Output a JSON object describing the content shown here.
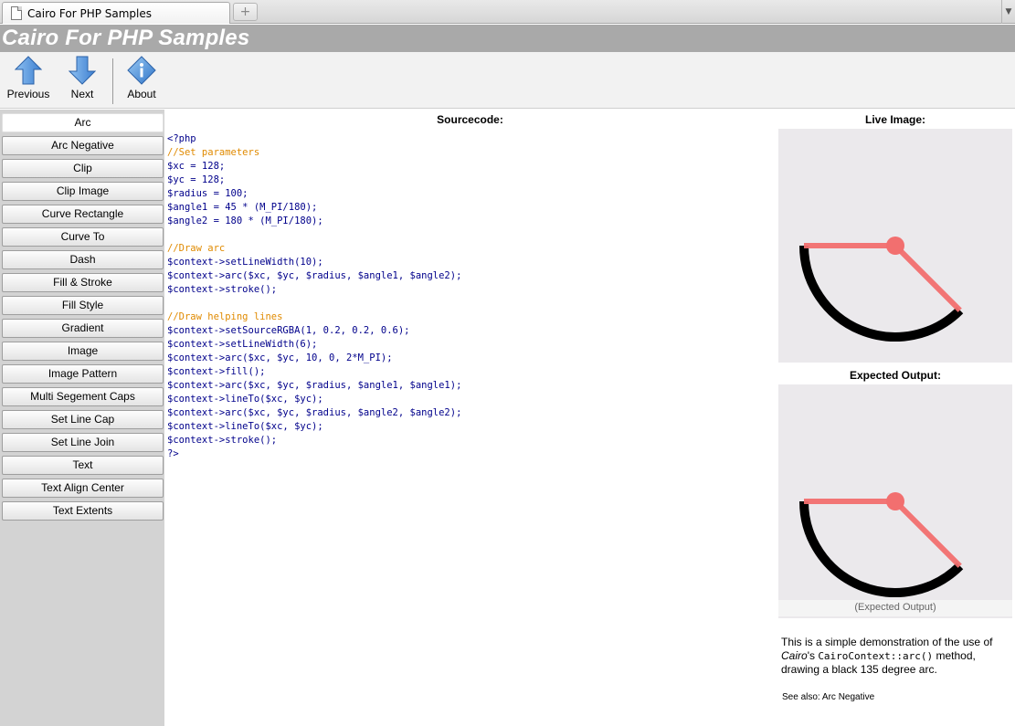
{
  "browser": {
    "tab_title": "Cairo For PHP Samples",
    "new_tab_symbol": "+",
    "tab_menu_symbol": "▼"
  },
  "header": {
    "title": "Cairo For PHP Samples"
  },
  "toolbar": {
    "previous_label": "Previous",
    "next_label": "Next",
    "about_label": "About",
    "icon_color": "#4a90d9"
  },
  "sidebar": {
    "items": [
      {
        "label": "Arc",
        "active": true
      },
      {
        "label": "Arc Negative"
      },
      {
        "label": "Clip"
      },
      {
        "label": "Clip Image"
      },
      {
        "label": "Curve Rectangle"
      },
      {
        "label": "Curve To"
      },
      {
        "label": "Dash"
      },
      {
        "label": "Fill & Stroke"
      },
      {
        "label": "Fill Style"
      },
      {
        "label": "Gradient"
      },
      {
        "label": "Image"
      },
      {
        "label": "Image Pattern"
      },
      {
        "label": "Multi Segement Caps"
      },
      {
        "label": "Set Line Cap"
      },
      {
        "label": "Set Line Join"
      },
      {
        "label": "Text"
      },
      {
        "label": "Text Align Center"
      },
      {
        "label": "Text Extents"
      }
    ]
  },
  "source": {
    "title": "Sourcecode:",
    "lines": [
      {
        "text": "<?php"
      },
      {
        "text": "//Set parameters",
        "comment": true
      },
      {
        "text": "$xc = 128;"
      },
      {
        "text": "$yc = 128;"
      },
      {
        "text": "$radius = 100;"
      },
      {
        "text": "$angle1 = 45 * (M_PI/180);"
      },
      {
        "text": "$angle2 = 180 * (M_PI/180);"
      },
      {
        "text": ""
      },
      {
        "text": "//Draw arc",
        "comment": true
      },
      {
        "text": "$context->setLineWidth(10);"
      },
      {
        "text": "$context->arc($xc, $yc, $radius, $angle1, $angle2);"
      },
      {
        "text": "$context->stroke();"
      },
      {
        "text": ""
      },
      {
        "text": "//Draw helping lines",
        "comment": true
      },
      {
        "text": "$context->setSourceRGBA(1, 0.2, 0.2, 0.6);"
      },
      {
        "text": "$context->setLineWidth(6);"
      },
      {
        "text": "$context->arc($xc, $yc, 10, 0, 2*M_PI);"
      },
      {
        "text": "$context->fill();"
      },
      {
        "text": "$context->arc($xc, $yc, $radius, $angle1, $angle1);"
      },
      {
        "text": "$context->lineTo($xc, $yc);"
      },
      {
        "text": "$context->arc($xc, $yc, $radius, $angle2, $angle2);"
      },
      {
        "text": "$context->lineTo($xc, $yc);"
      },
      {
        "text": "$context->stroke();"
      },
      {
        "text": "?>"
      }
    ]
  },
  "live_image": {
    "title": "Live Image:"
  },
  "expected_output": {
    "title": "Expected Output:",
    "caption": "(Expected Output)"
  },
  "description": {
    "prefix": "This is a simple demonstration of the use of ",
    "cairo": "Cairo",
    "possessive": "'s ",
    "method": "CairoContext::arc()",
    "suffix": " method, drawing a black 135 degree arc."
  },
  "see_also": {
    "label": "See also: ",
    "link": "Arc Negative"
  },
  "colors": {
    "header_bg": "#a9a9a9",
    "sidebar_bg": "#d3d3d3",
    "code_text": "#00008b",
    "code_comment": "#e08a00",
    "canvas_bg": "#ebe9ec",
    "helper_line": "#f26f6f"
  }
}
